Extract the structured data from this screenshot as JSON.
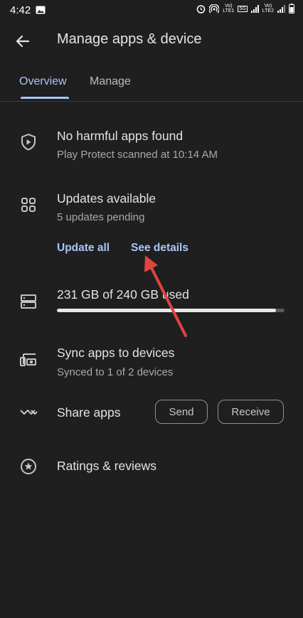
{
  "status_bar": {
    "time": "4:42",
    "network_1": "Vo)\nLTE1",
    "network_5g": "5G",
    "network_2": "Vo)\nLTE2"
  },
  "header": {
    "title": "Manage apps & device"
  },
  "tabs": [
    {
      "label": "Overview",
      "active": true
    },
    {
      "label": "Manage",
      "active": false
    }
  ],
  "protect": {
    "title": "No harmful apps found",
    "subtitle": "Play Protect scanned at 10:14 AM"
  },
  "updates": {
    "title": "Updates available",
    "subtitle": "5 updates pending",
    "update_all_label": "Update all",
    "see_details_label": "See details"
  },
  "storage": {
    "title": "231 GB of 240 GB used",
    "used_fraction": 0.9625
  },
  "sync": {
    "title": "Sync apps to devices",
    "subtitle": "Synced to 1 of 2 devices"
  },
  "share": {
    "title": "Share apps",
    "send_label": "Send",
    "receive_label": "Receive"
  },
  "ratings": {
    "title": "Ratings & reviews"
  },
  "colors": {
    "background": "#1f1f1f",
    "accent": "#a8c7fa",
    "annotation_arrow": "#e0443e"
  }
}
